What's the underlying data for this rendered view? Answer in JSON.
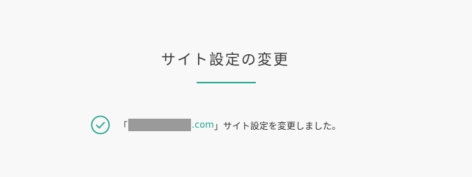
{
  "title": "サイト設定の変更",
  "colors": {
    "accent": "#21a58f",
    "mask": "#9a9a9a"
  },
  "message": {
    "open_bracket": "「",
    "domain_suffix": ".com",
    "text": "」サイト設定を変更しました。",
    "status_icon": "check-circle-icon"
  }
}
